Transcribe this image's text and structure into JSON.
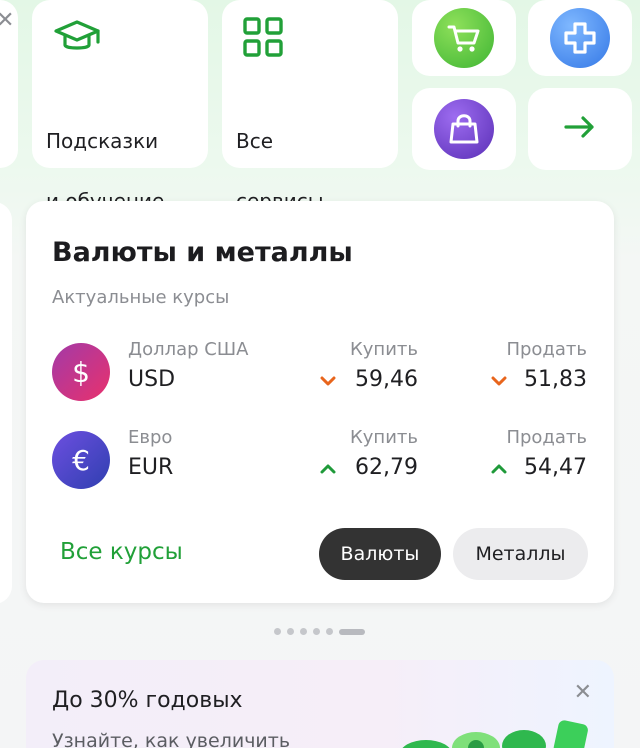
{
  "tiles": {
    "hints": {
      "line1": "Подсказки",
      "line2": "и обучение",
      "icon": "graduation-cap-icon"
    },
    "services": {
      "line1": "Все",
      "line2": "сервисы",
      "icon": "grid-icon"
    },
    "apps": [
      {
        "icon": "shopping-cart-icon",
        "color": "#4cc23d"
      },
      {
        "icon": "medical-cross-icon",
        "color": "#3e8ff0"
      },
      {
        "icon": "shopping-bag-icon",
        "color": "#6a3fc8"
      },
      {
        "icon": "arrow-right-icon",
        "color": "#21a038"
      }
    ]
  },
  "currency": {
    "title": "Валюты и металлы",
    "subtitle": "Актуальные курсы",
    "buy_label": "Купить",
    "sell_label": "Продать",
    "rows": [
      {
        "name": "Доллар США",
        "code": "USD",
        "symbol": "$",
        "buy": "59,46",
        "sell": "51,83",
        "buy_trend": "down",
        "sell_trend": "down"
      },
      {
        "name": "Евро",
        "code": "EUR",
        "symbol": "€",
        "buy": "62,79",
        "sell": "54,47",
        "buy_trend": "up",
        "sell_trend": "up"
      }
    ],
    "all_rates": "Все курсы",
    "tabs": [
      "Валюты",
      "Металлы"
    ],
    "active_tab": "Валюты"
  },
  "promo": {
    "title": "До 30% годовых",
    "subtitle": "Узнайте, как увеличить"
  },
  "colors": {
    "accent": "#21a038",
    "down": "#e8651c",
    "up": "#1f9a3a"
  }
}
